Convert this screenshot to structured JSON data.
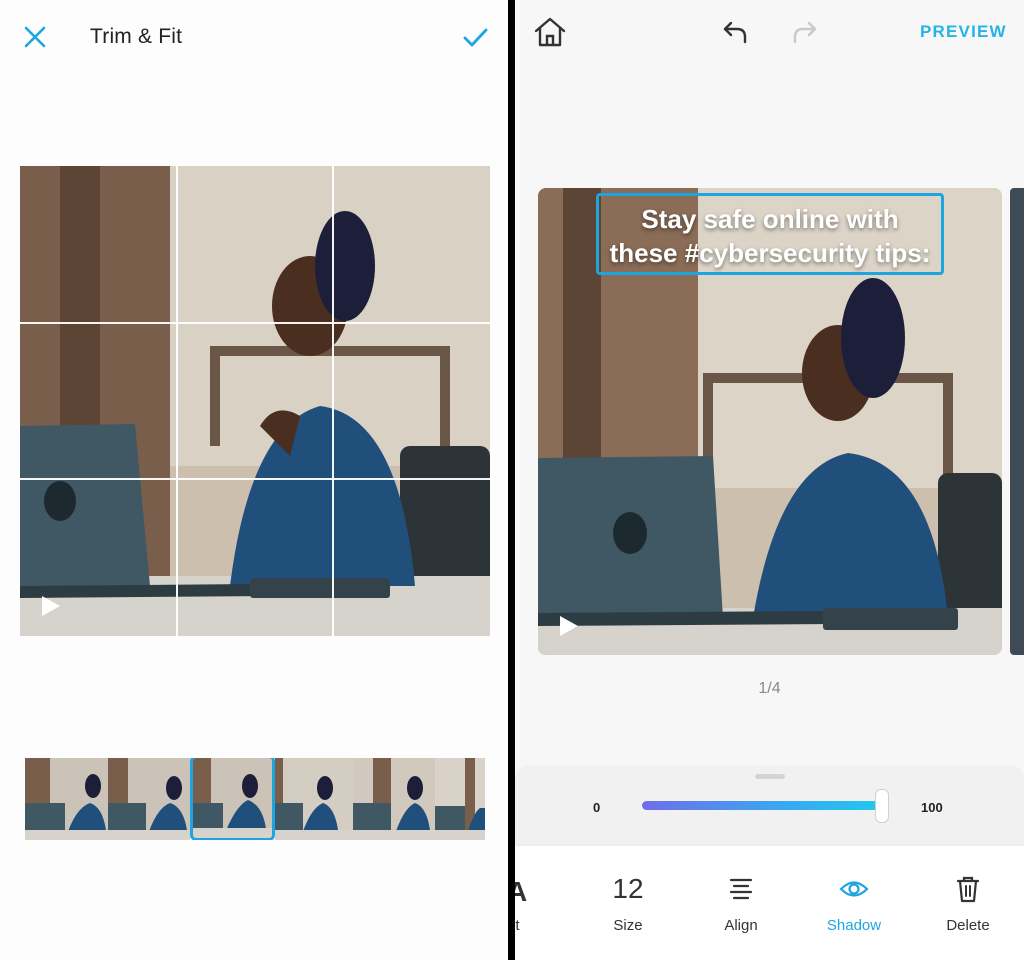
{
  "left_panel": {
    "title": "Trim & Fit",
    "close_icon": "close-icon",
    "confirm_icon": "check-icon",
    "filmstrip_frames": 6,
    "selected_frame_index": 2
  },
  "right_panel": {
    "preview_label": "PREVIEW",
    "caption_line1": "Stay safe online with",
    "caption_line2": "these #cybersecurity tips:",
    "page_indicator": "1/4",
    "slider": {
      "min_label": "0",
      "max_label": "100",
      "value_fraction": 0.96
    },
    "tools": [
      {
        "label": "nt",
        "glyph": "A"
      },
      {
        "label": "Size",
        "value": "12"
      },
      {
        "label": "Align"
      },
      {
        "label": "Shadow"
      },
      {
        "label": "Delete"
      }
    ]
  },
  "colors": {
    "accent": "#1ea5e0",
    "preview": "#26b3e8"
  }
}
